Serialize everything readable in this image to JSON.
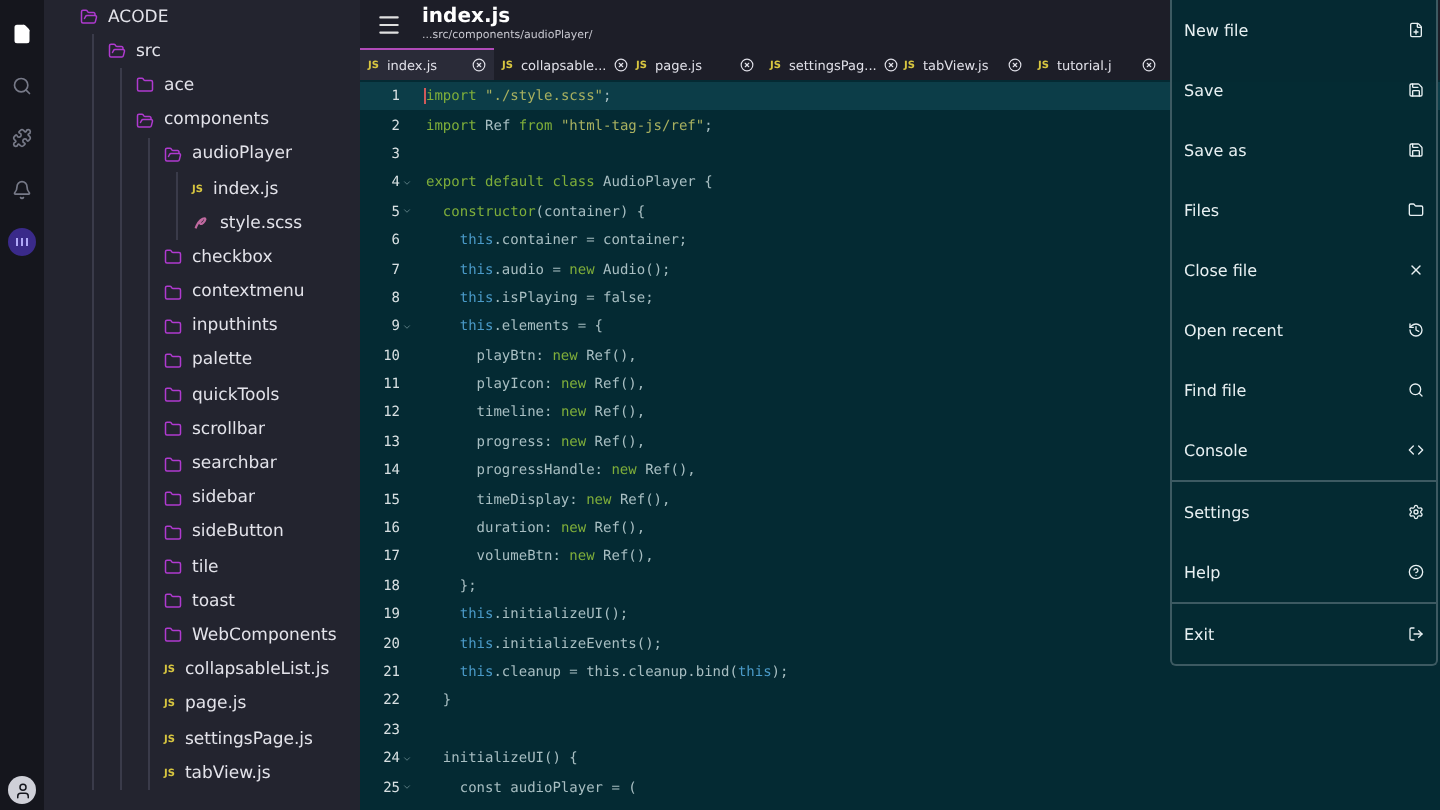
{
  "activity_bar": [
    {
      "selected": true
    },
    {
      "selected": false
    },
    {
      "selected": false
    },
    {
      "selected": false
    },
    {
      "selected": false
    }
  ],
  "file_tree": {
    "name": "ACODE",
    "kind": "folder",
    "expanded": true,
    "children": [
      {
        "name": "src",
        "kind": "folder",
        "expanded": true,
        "children": [
          {
            "name": "ace",
            "kind": "folder",
            "expanded": false
          },
          {
            "name": "components",
            "kind": "folder",
            "expanded": true,
            "children": [
              {
                "name": "audioPlayer",
                "kind": "folder",
                "expanded": true,
                "children": [
                  {
                    "name": "index.js",
                    "kind": "js",
                    "badge": "JS"
                  },
                  {
                    "name": "style.scss",
                    "kind": "scss"
                  }
                ]
              },
              {
                "name": "checkbox",
                "kind": "folder",
                "expanded": false
              },
              {
                "name": "contextmenu",
                "kind": "folder",
                "expanded": false
              },
              {
                "name": "inputhints",
                "kind": "folder",
                "expanded": false
              },
              {
                "name": "palette",
                "kind": "folder",
                "expanded": false
              },
              {
                "name": "quickTools",
                "kind": "folder",
                "expanded": false
              },
              {
                "name": "scrollbar",
                "kind": "folder",
                "expanded": false
              },
              {
                "name": "searchbar",
                "kind": "folder",
                "expanded": false
              },
              {
                "name": "sidebar",
                "kind": "folder",
                "expanded": false
              },
              {
                "name": "sideButton",
                "kind": "folder",
                "expanded": false
              },
              {
                "name": "tile",
                "kind": "folder",
                "expanded": false
              },
              {
                "name": "toast",
                "kind": "folder",
                "expanded": false
              },
              {
                "name": "WebComponents",
                "kind": "folder",
                "expanded": false
              },
              {
                "name": "collapsableList.js",
                "kind": "js",
                "badge": "JS"
              },
              {
                "name": "page.js",
                "kind": "js",
                "badge": "JS"
              },
              {
                "name": "settingsPage.js",
                "kind": "js",
                "badge": "JS"
              },
              {
                "name": "tabView.js",
                "kind": "js",
                "badge": "JS"
              }
            ]
          }
        ]
      }
    ]
  },
  "header": {
    "title": "index.js",
    "path": "...src/components/audioPlayer/"
  },
  "tabs": [
    {
      "badge": "JS",
      "label": "index.js",
      "selected": true
    },
    {
      "badge": "JS",
      "label": "collapsable...",
      "selected": false
    },
    {
      "badge": "JS",
      "label": "page.js",
      "selected": false
    },
    {
      "badge": "JS",
      "label": "settingsPag...",
      "selected": false
    },
    {
      "badge": "JS",
      "label": "tabView.js",
      "selected": false
    },
    {
      "badge": "JS",
      "label": "tutorial.j",
      "selected": false
    }
  ],
  "code_lines": [
    {
      "number": "1",
      "active": true,
      "foldable": false,
      "code": [
        {
          "kind": "keyword",
          "text": "import "
        },
        {
          "kind": "string",
          "text": "\"./style.scss\""
        },
        {
          "kind": "plain",
          "text": ";"
        }
      ]
    },
    {
      "number": "2",
      "active": false,
      "foldable": false,
      "code": [
        {
          "kind": "keyword",
          "text": "import"
        },
        {
          "kind": "plain",
          "text": " Ref "
        },
        {
          "kind": "keyword",
          "text": "from "
        },
        {
          "kind": "string",
          "text": "\"html-tag-js/ref\""
        },
        {
          "kind": "plain",
          "text": ";"
        }
      ]
    },
    {
      "number": "3",
      "active": false,
      "foldable": false
    },
    {
      "number": "4",
      "active": false,
      "foldable": true,
      "code": [
        {
          "kind": "keyword",
          "text": "export default class"
        },
        {
          "kind": "plain",
          "text": " AudioPlayer {"
        }
      ]
    },
    {
      "number": "5",
      "active": false,
      "foldable": true,
      "code": [
        {
          "kind": "keyword",
          "text": "  constructor"
        },
        {
          "kind": "plain",
          "text": "(container) {"
        }
      ]
    },
    {
      "number": "6",
      "active": false,
      "foldable": false,
      "code": [
        {
          "kind": "this",
          "text": "    this"
        },
        {
          "kind": "plain",
          "text": ".container = container;"
        }
      ]
    },
    {
      "number": "7",
      "active": false,
      "foldable": false,
      "code": [
        {
          "kind": "this",
          "text": "    this"
        },
        {
          "kind": "plain",
          "text": ".audio = "
        },
        {
          "kind": "keyword",
          "text": "new"
        },
        {
          "kind": "plain",
          "text": " Audio();"
        }
      ]
    },
    {
      "number": "8",
      "active": false,
      "foldable": false,
      "code": [
        {
          "kind": "this",
          "text": "    this"
        },
        {
          "kind": "plain",
          "text": ".isPlaying = false;"
        }
      ]
    },
    {
      "number": "9",
      "active": false,
      "foldable": true,
      "code": [
        {
          "kind": "this",
          "text": "    this"
        },
        {
          "kind": "plain",
          "text": ".elements = {"
        }
      ]
    },
    {
      "number": "10",
      "active": false,
      "foldable": false,
      "code": [
        {
          "kind": "plain",
          "text": "      playBtn: "
        },
        {
          "kind": "keyword",
          "text": "new"
        },
        {
          "kind": "plain",
          "text": " Ref(),"
        }
      ]
    },
    {
      "number": "11",
      "active": false,
      "foldable": false,
      "code": [
        {
          "kind": "plain",
          "text": "      playIcon: "
        },
        {
          "kind": "keyword",
          "text": "new"
        },
        {
          "kind": "plain",
          "text": " Ref(),"
        }
      ]
    },
    {
      "number": "12",
      "active": false,
      "foldable": false,
      "code": [
        {
          "kind": "plain",
          "text": "      timeline: "
        },
        {
          "kind": "keyword",
          "text": "new"
        },
        {
          "kind": "plain",
          "text": " Ref(),"
        }
      ]
    },
    {
      "number": "13",
      "active": false,
      "foldable": false,
      "code": [
        {
          "kind": "plain",
          "text": "      progress: "
        },
        {
          "kind": "keyword",
          "text": "new"
        },
        {
          "kind": "plain",
          "text": " Ref(),"
        }
      ]
    },
    {
      "number": "14",
      "active": false,
      "foldable": false,
      "code": [
        {
          "kind": "plain",
          "text": "      progressHandle: "
        },
        {
          "kind": "keyword",
          "text": "new"
        },
        {
          "kind": "plain",
          "text": " Ref(),"
        }
      ]
    },
    {
      "number": "15",
      "active": false,
      "foldable": false,
      "code": [
        {
          "kind": "plain",
          "text": "      timeDisplay: "
        },
        {
          "kind": "keyword",
          "text": "new"
        },
        {
          "kind": "plain",
          "text": " Ref(),"
        }
      ]
    },
    {
      "number": "16",
      "active": false,
      "foldable": false,
      "code": [
        {
          "kind": "plain",
          "text": "      duration: "
        },
        {
          "kind": "keyword",
          "text": "new"
        },
        {
          "kind": "plain",
          "text": " Ref(),"
        }
      ]
    },
    {
      "number": "17",
      "active": false,
      "foldable": false,
      "code": [
        {
          "kind": "plain",
          "text": "      volumeBtn: "
        },
        {
          "kind": "keyword",
          "text": "new"
        },
        {
          "kind": "plain",
          "text": " Ref(),"
        }
      ]
    },
    {
      "number": "18",
      "active": false,
      "foldable": false,
      "code": [
        {
          "kind": "plain",
          "text": "    };"
        }
      ]
    },
    {
      "number": "19",
      "active": false,
      "foldable": false,
      "code": [
        {
          "kind": "this",
          "text": "    this"
        },
        {
          "kind": "plain",
          "text": ".initializeUI();"
        }
      ]
    },
    {
      "number": "20",
      "active": false,
      "foldable": false,
      "code": [
        {
          "kind": "this",
          "text": "    this"
        },
        {
          "kind": "plain",
          "text": ".initializeEvents();"
        }
      ]
    },
    {
      "number": "21",
      "active": false,
      "foldable": false,
      "code": [
        {
          "kind": "this",
          "text": "    this"
        },
        {
          "kind": "plain",
          "text": ".cleanup = this.cleanup.bind("
        },
        {
          "kind": "this",
          "text": "this"
        },
        {
          "kind": "plain",
          "text": ");"
        }
      ]
    },
    {
      "number": "22",
      "active": false,
      "foldable": false,
      "code": [
        {
          "kind": "plain",
          "text": "  }"
        }
      ]
    },
    {
      "number": "23",
      "active": false,
      "foldable": false
    },
    {
      "number": "24",
      "active": false,
      "foldable": true,
      "code": [
        {
          "kind": "plain",
          "text": "  initializeUI() {"
        }
      ]
    },
    {
      "number": "25",
      "active": false,
      "foldable": true,
      "code": [
        {
          "kind": "plain",
          "text": "    const audioPlayer = ("
        }
      ]
    }
  ],
  "menu": [
    {
      "label": "New file",
      "divider": false
    },
    {
      "label": "Save",
      "divider": false
    },
    {
      "label": "Save as",
      "divider": false
    },
    {
      "label": "Files",
      "divider": false
    },
    {
      "label": "Close file",
      "divider": false
    },
    {
      "label": "Open recent",
      "divider": false
    },
    {
      "label": "Find file",
      "divider": false
    },
    {
      "label": "Console",
      "divider": true
    },
    {
      "label": "Settings",
      "divider": false
    },
    {
      "label": "Help",
      "divider": true
    },
    {
      "label": "Exit",
      "divider": false
    }
  ]
}
